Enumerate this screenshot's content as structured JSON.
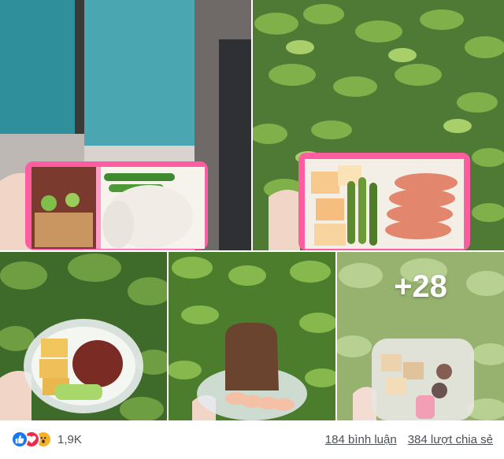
{
  "post": {
    "more_photos": "+28",
    "reaction_count": "1,9K",
    "comments": "184 bình luận",
    "shares": "384 lượt chia sẻ"
  },
  "reactions": [
    "like-icon",
    "love-icon",
    "wow-icon"
  ],
  "colors": {
    "like": "#1877f2",
    "love": "#f02849",
    "wow": "#f7b125",
    "text": "#4b4f56"
  }
}
